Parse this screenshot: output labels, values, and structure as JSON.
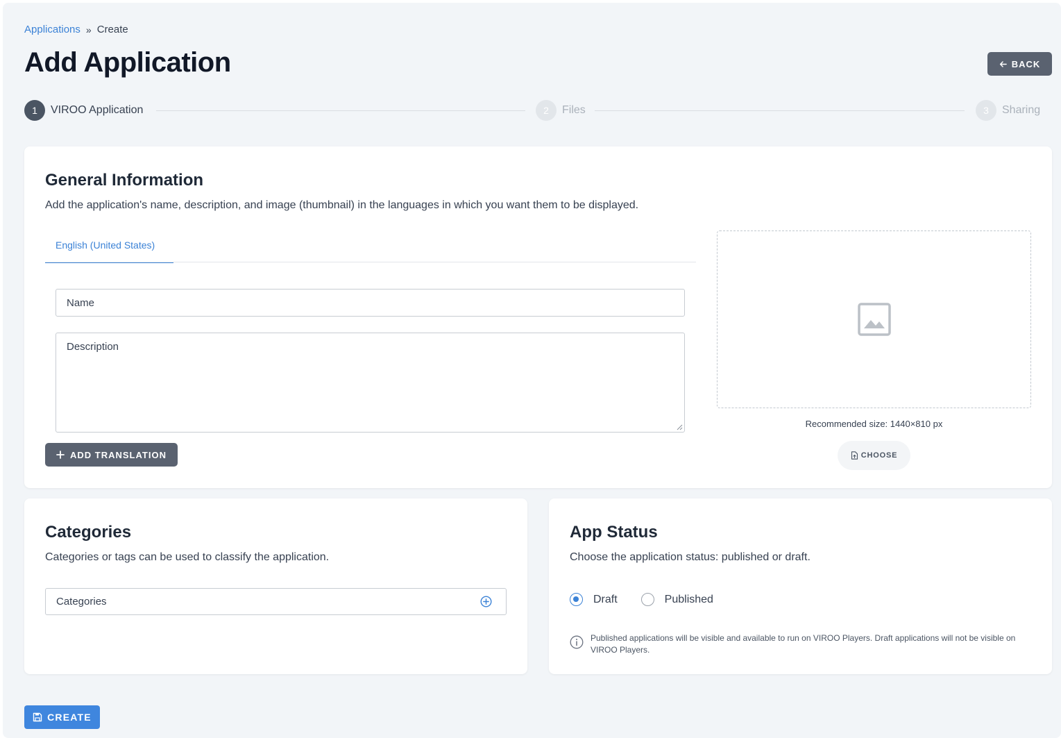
{
  "breadcrumb": {
    "parent": "Applications",
    "separator": "»",
    "current": "Create"
  },
  "page_title": "Add Application",
  "back_button": {
    "label": "BACK",
    "icon": "arrow-left-icon"
  },
  "stepper": {
    "steps": [
      {
        "number": "1",
        "label": "VIROO Application",
        "state": "active"
      },
      {
        "number": "2",
        "label": "Files",
        "state": "inactive"
      },
      {
        "number": "3",
        "label": "Sharing",
        "state": "inactive"
      }
    ]
  },
  "general_information": {
    "title": "General Information",
    "description": "Add the application's name, description, and image (thumbnail) in the languages in which you want them to be displayed.",
    "tab_label": "English (United States)",
    "name_placeholder": "Name",
    "description_placeholder": "Description",
    "add_translation_label": "ADD TRANSLATION",
    "image": {
      "placeholder_icon": "image-icon",
      "recommended_size": "Recommended size: 1440×810 px",
      "choose_label": "CHOOSE",
      "choose_icon": "file-upload-icon"
    }
  },
  "categories": {
    "title": "Categories",
    "description": "Categories or tags can be used to classify the application.",
    "input_placeholder": "Categories",
    "add_icon": "plus-circle-icon"
  },
  "app_status": {
    "title": "App Status",
    "description": "Choose the application status: published or draft.",
    "options": [
      {
        "label": "Draft",
        "checked": true
      },
      {
        "label": "Published",
        "checked": false
      }
    ],
    "note": "Published applications will be visible and available to run on VIROO Players. Draft applications will not be visible on VIROO Players."
  },
  "create_button": {
    "label": "CREATE",
    "icon": "save-icon"
  },
  "colors": {
    "accent": "#3b82d6",
    "dark_button": "#5a6270",
    "page_background": "#f2f5f8",
    "card_background": "#ffffff"
  }
}
